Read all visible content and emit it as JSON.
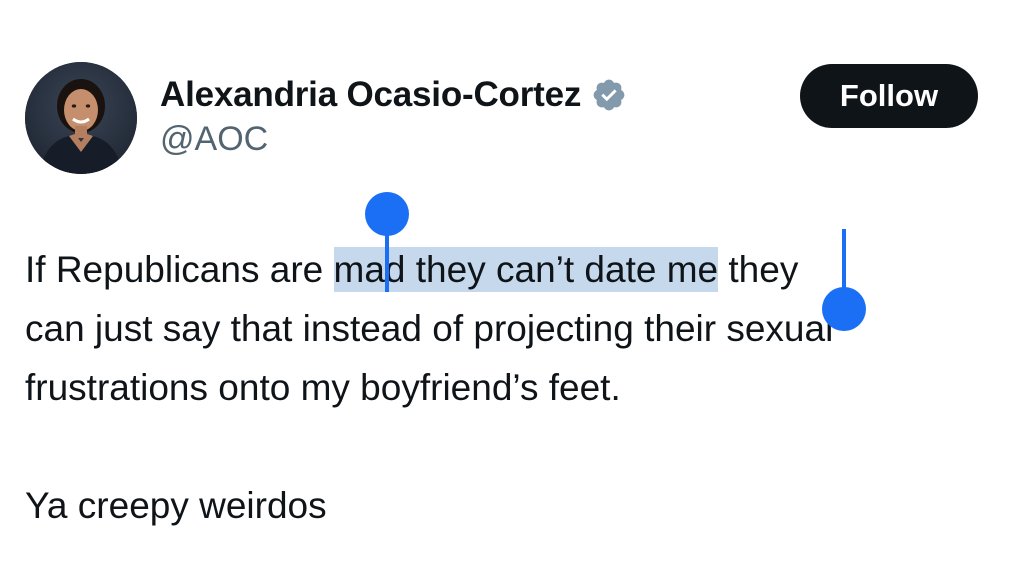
{
  "tweet": {
    "author": {
      "display_name": "Alexandria Ocasio-Cortez",
      "handle": "@AOC",
      "verified_icon": "verified-badge-icon",
      "avatar": "profile-photo"
    },
    "follow_label": "Follow",
    "body": {
      "line1_pre": "If Republicans are ",
      "line1_selected": "mad they can’t date me",
      "line1_post": " they",
      "line2": "can just say that instead of projecting their sexual",
      "line3": "frustrations onto my boyfriend’s feet.",
      "line4": "Ya creepy weirdos"
    },
    "selection": {
      "selected_text": "mad they can’t date me",
      "highlight_color": "#c6d8ec",
      "handle_color": "#1a6ff5"
    }
  },
  "colors": {
    "text": "#0f1419",
    "secondary_text": "#536471",
    "button_bg": "#0f1419",
    "button_text": "#ffffff",
    "badge": "#829aab"
  }
}
